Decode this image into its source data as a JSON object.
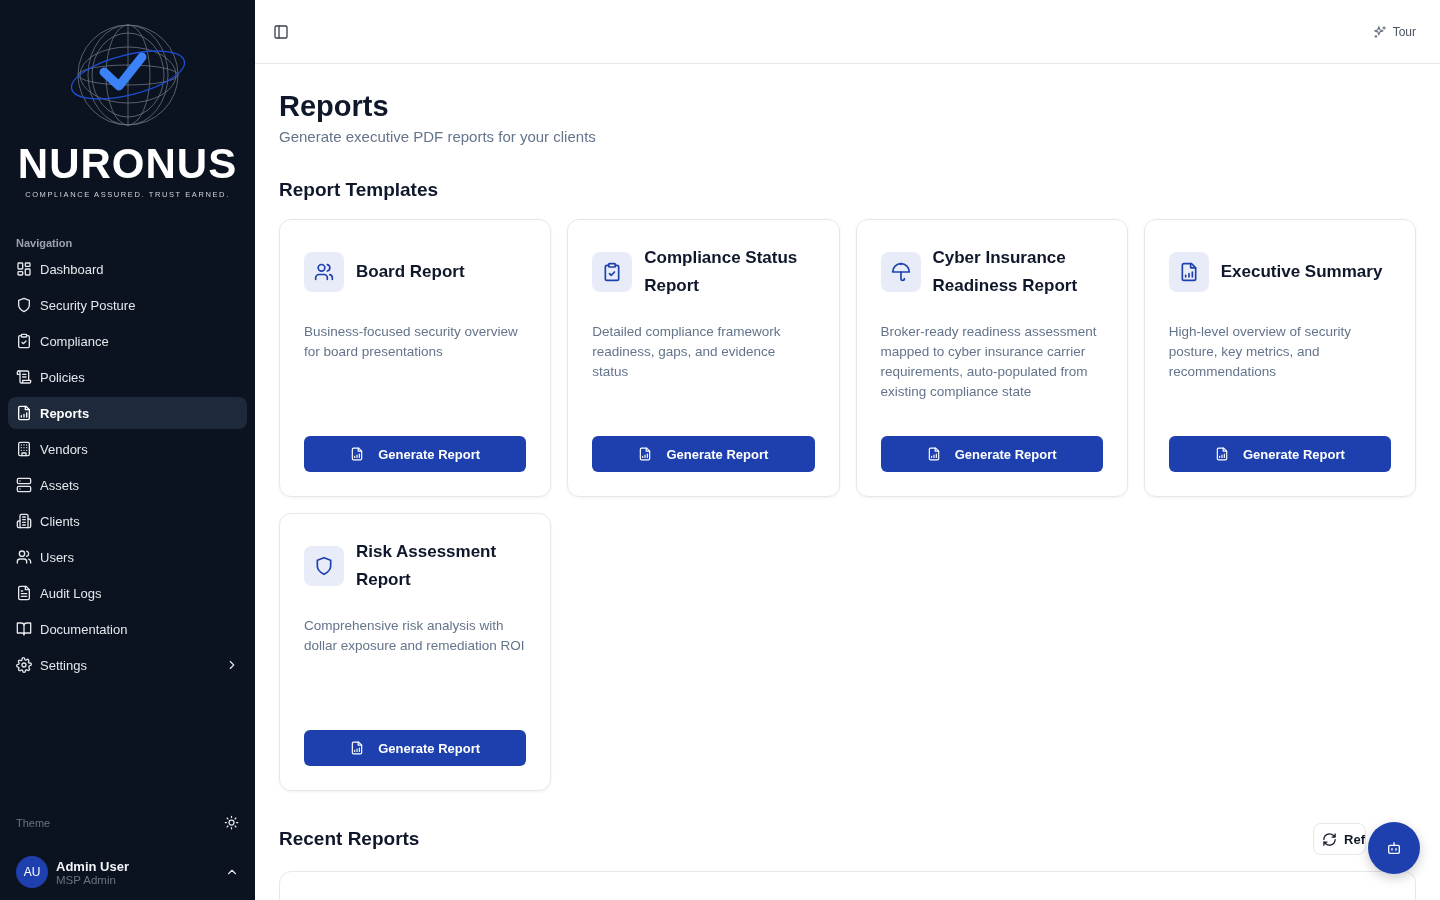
{
  "sidebar": {
    "brand": {
      "name": "NURONUS",
      "tagline": "COMPLIANCE ASSURED. TRUST EARNED."
    },
    "nav_heading": "Navigation",
    "items": [
      {
        "label": "Dashboard",
        "selected": false,
        "expandable": false
      },
      {
        "label": "Security Posture",
        "selected": false,
        "expandable": false
      },
      {
        "label": "Compliance",
        "selected": false,
        "expandable": false
      },
      {
        "label": "Policies",
        "selected": false,
        "expandable": false
      },
      {
        "label": "Reports",
        "selected": true,
        "expandable": false
      },
      {
        "label": "Vendors",
        "selected": false,
        "expandable": false
      },
      {
        "label": "Assets",
        "selected": false,
        "expandable": false
      },
      {
        "label": "Clients",
        "selected": false,
        "expandable": false
      },
      {
        "label": "Users",
        "selected": false,
        "expandable": false
      },
      {
        "label": "Audit Logs",
        "selected": false,
        "expandable": false
      },
      {
        "label": "Documentation",
        "selected": false,
        "expandable": false
      },
      {
        "label": "Settings",
        "selected": false,
        "expandable": true
      }
    ],
    "theme_label": "Theme",
    "user": {
      "initials": "AU",
      "name": "Admin User",
      "role": "MSP Admin"
    }
  },
  "header": {
    "tour": "Tour"
  },
  "page": {
    "title": "Reports",
    "subtitle": "Generate executive PDF reports for your clients"
  },
  "templates": {
    "heading": "Report Templates",
    "cards": [
      {
        "title": "Board Report",
        "description": "Business-focused security overview for board presentations",
        "button": "Generate Report"
      },
      {
        "title": "Compliance Status Report",
        "description": "Detailed compliance framework readiness, gaps, and evidence status",
        "button": "Generate Report"
      },
      {
        "title": "Cyber Insurance Readiness Report",
        "description": "Broker-ready readiness assessment mapped to cyber insurance carrier requirements, auto-populated from existing compliance state",
        "button": "Generate Report"
      },
      {
        "title": "Executive Summary",
        "description": "High-level overview of security posture, key metrics, and recommendations",
        "button": "Generate Report"
      },
      {
        "title": "Risk Assessment Report",
        "description": "Comprehensive risk analysis with dollar exposure and remediation ROI",
        "button": "Generate Report"
      }
    ]
  },
  "recent": {
    "heading": "Recent Reports",
    "refresh": "Ref"
  }
}
